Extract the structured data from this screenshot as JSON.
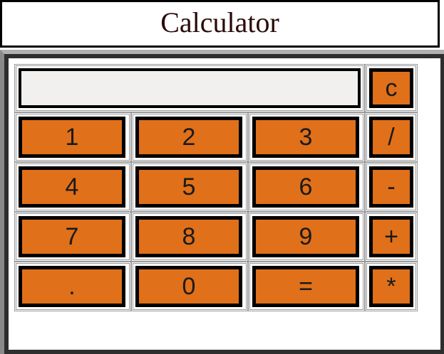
{
  "title": "Calculator",
  "display": {
    "value": ""
  },
  "clear_label": "c",
  "rows": [
    [
      {
        "label": "1"
      },
      {
        "label": "2"
      },
      {
        "label": "3"
      },
      {
        "label": "/"
      }
    ],
    [
      {
        "label": "4"
      },
      {
        "label": "5"
      },
      {
        "label": "6"
      },
      {
        "label": "-"
      }
    ],
    [
      {
        "label": "7"
      },
      {
        "label": "8"
      },
      {
        "label": "9"
      },
      {
        "label": "+"
      }
    ],
    [
      {
        "label": "."
      },
      {
        "label": "0"
      },
      {
        "label": "="
      },
      {
        "label": "*"
      }
    ]
  ],
  "colors": {
    "button": "#e07019",
    "display_bg": "#f2f0ee",
    "frame": "#2e2e2e",
    "title_text": "#2a0a0a"
  }
}
